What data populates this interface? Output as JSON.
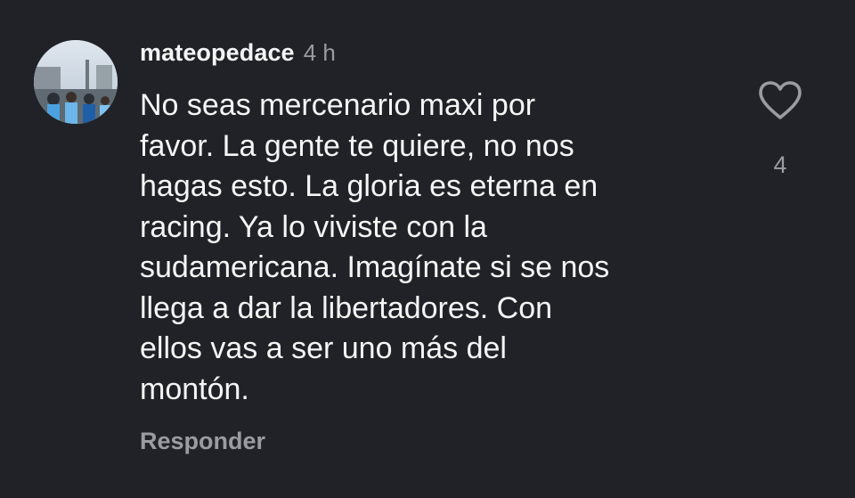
{
  "comment": {
    "username": "mateopedace",
    "time": "4 h",
    "text_lines": [
      "No seas mercenario maxi por",
      "favor. La gente te quiere, no nos",
      "hagas esto. La gloria es eterna en",
      "racing. Ya lo viviste con la",
      "sudamericana. Imagínate si se nos",
      "llega a dar la libertadores. Con",
      "ellos vas a ser uno más del",
      "montón."
    ],
    "reply_label": "Responder",
    "like_count": "4",
    "like_icon": "heart-outline-icon"
  },
  "colors": {
    "background": "#202227",
    "primary_text": "#f5f5f5",
    "secondary_text": "#9a9ca1"
  }
}
